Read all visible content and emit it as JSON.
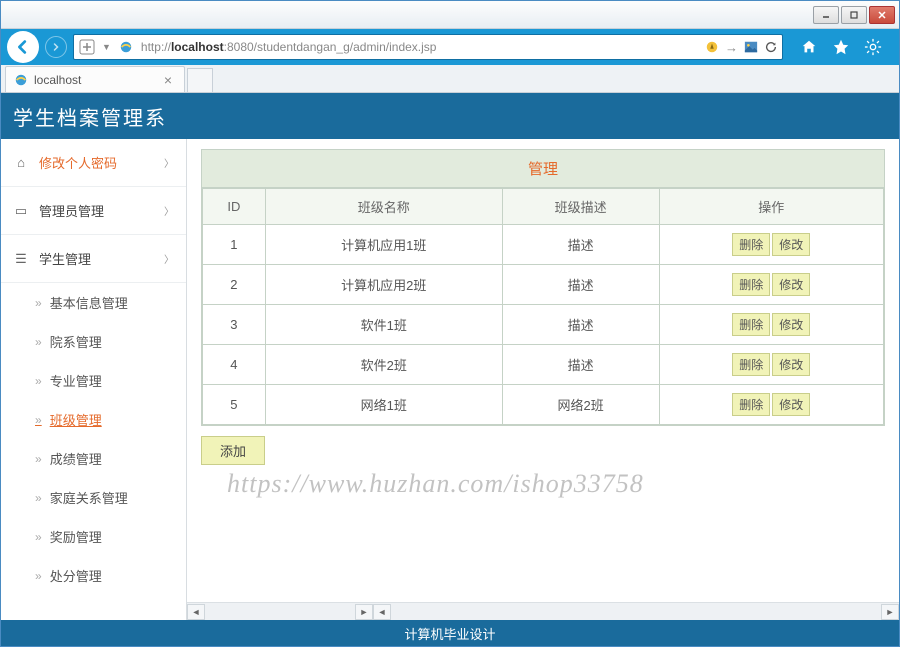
{
  "window": {
    "tab_title": "localhost",
    "url_prefix": "http://",
    "url_host": "localhost",
    "url_rest": ":8080/studentdangan_g/admin/index.jsp"
  },
  "app": {
    "title": "学生档案管理系",
    "footer": "计算机毕业设计"
  },
  "sidebar": {
    "change_pwd": "修改个人密码",
    "admin_mgmt": "管理员管理",
    "student_mgmt": "学生管理",
    "subs": [
      "基本信息管理",
      "院系管理",
      "专业管理",
      "班级管理",
      "成绩管理",
      "家庭关系管理",
      "奖励管理",
      "处分管理"
    ],
    "active_index": 3
  },
  "panel": {
    "title": "管理",
    "columns": [
      "ID",
      "班级名称",
      "班级描述",
      "操作"
    ],
    "rows": [
      {
        "id": "1",
        "name": "计算机应用1班",
        "desc": "描述"
      },
      {
        "id": "2",
        "name": "计算机应用2班",
        "desc": "描述"
      },
      {
        "id": "3",
        "name": "软件1班",
        "desc": "描述"
      },
      {
        "id": "4",
        "name": "软件2班",
        "desc": "描述"
      },
      {
        "id": "5",
        "name": "网络1班",
        "desc": "网络2班"
      }
    ],
    "btn_delete": "删除",
    "btn_edit": "修改",
    "btn_add": "添加"
  },
  "watermark": "https://www.huzhan.com/ishop33758"
}
